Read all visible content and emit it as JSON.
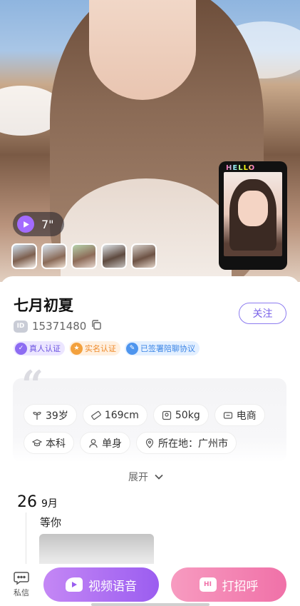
{
  "hero": {
    "video_duration": "7\"",
    "video_card_label": "HELLO",
    "thumbnail_count": 5
  },
  "profile": {
    "name": "七月初夏",
    "id_badge": "ID",
    "id": "15371480",
    "follow_label": "关注",
    "badges": [
      {
        "label": "真人认证",
        "icon": "verified-icon"
      },
      {
        "label": "实名认证",
        "icon": "id-card-icon"
      },
      {
        "label": "已签署陪聊协议",
        "icon": "agreement-icon"
      }
    ]
  },
  "info": {
    "tags": [
      {
        "label": "39岁",
        "icon": "age-icon"
      },
      {
        "label": "169cm",
        "icon": "ruler-icon"
      },
      {
        "label": "50kg",
        "icon": "scale-icon"
      },
      {
        "label": "电商",
        "icon": "job-icon"
      },
      {
        "label": "本科",
        "icon": "education-icon"
      },
      {
        "label": "单身",
        "icon": "person-icon"
      },
      {
        "label": "所在地：广州市",
        "icon": "location-icon"
      }
    ],
    "expand_label": "展开"
  },
  "moment": {
    "day": "26",
    "month": "9月",
    "text": "等你"
  },
  "bottom": {
    "private_msg_label": "私信",
    "video_voice_label": "视频语音",
    "greet_label": "打招呼",
    "greet_icon_text": "HI"
  },
  "colors": {
    "accent_purple": "#9b5df0",
    "accent_pink": "#f071a8"
  }
}
